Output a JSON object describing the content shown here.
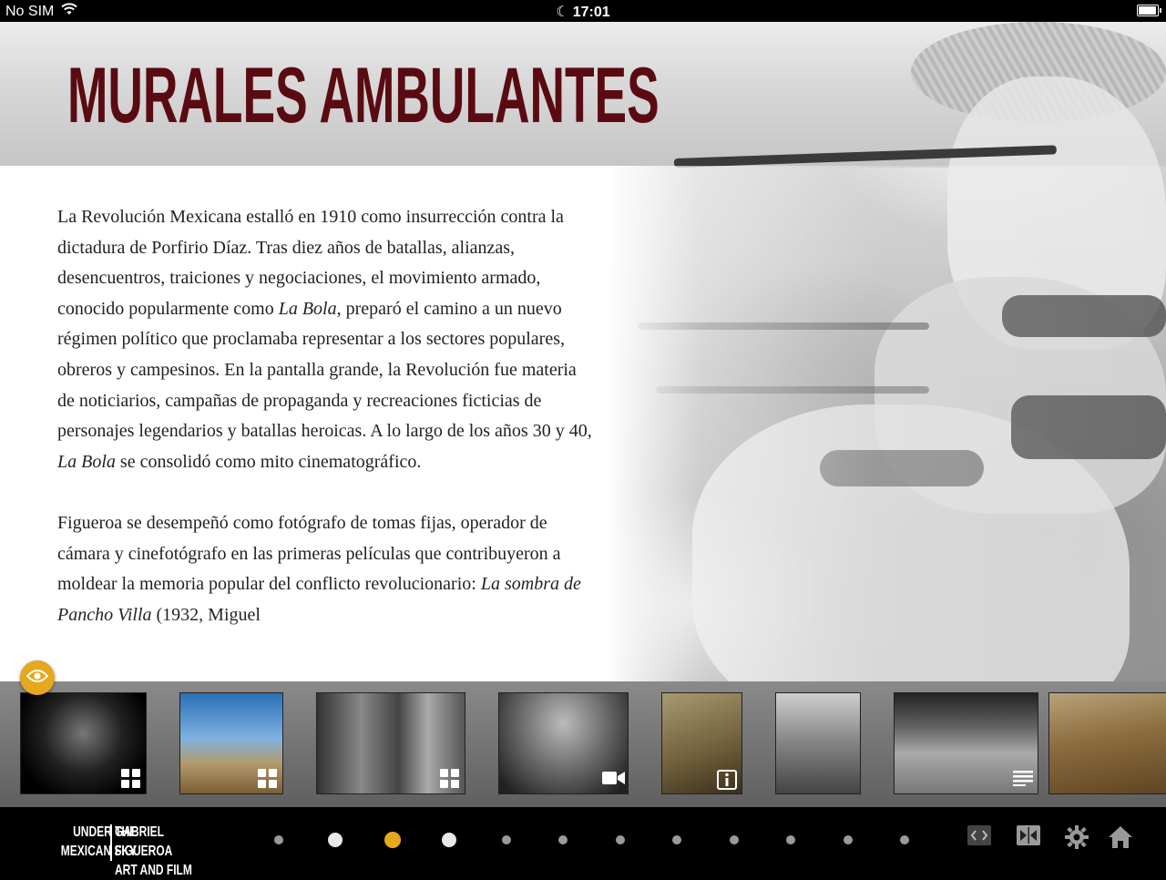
{
  "status_bar": {
    "carrier": "No SIM",
    "time": "17:01",
    "battery_level": 0.95
  },
  "page": {
    "title": "MURALES AMBULANTES",
    "title_color": "#5a0b12"
  },
  "article": {
    "paragraph1_a": "La Revolución Mexicana estalló en 1910 como insurrección contra la dictadura de Porfirio Díaz. Tras diez años de batallas, alianzas, desencuentros, traiciones y negociaciones, el movimiento armado, conocido popularmente como ",
    "paragraph1_italic1": "La Bola,",
    "paragraph1_b": " preparó el camino a un nuevo régimen político que proclamaba representar a los sectores populares, obreros y campesinos. En la pantalla grande, la Revolución fue materia de noticiarios, campañas de propaganda y recreaciones ficticias de personajes legendarios y batallas heroicas. A lo largo de los años 30 y 40, ",
    "paragraph1_italic2": "La Bola",
    "paragraph1_c": " se consolidó como mito cinematográfico.",
    "paragraph2_a": "Figueroa se desempeñó como fotógrafo de tomas fijas, operador de cámara y cinefotógrafo en las primeras películas que contribuyeron a moldear la memoria popular del conflicto revolucionario: ",
    "paragraph2_italic": "La sombra de Pancho Villa",
    "paragraph2_b": " (1932, Miguel"
  },
  "view_button": {
    "icon": "eye-icon",
    "color": "#e6a81c"
  },
  "thumbnails": [
    {
      "kind": "gallery",
      "icon": "grid-icon"
    },
    {
      "kind": "gallery",
      "icon": "grid-icon"
    },
    {
      "kind": "gallery",
      "icon": "grid-icon"
    },
    {
      "kind": "video",
      "icon": "video-camera-icon"
    },
    {
      "kind": "info",
      "icon": "info-icon"
    },
    {
      "kind": "image",
      "icon": ""
    },
    {
      "kind": "text",
      "icon": "text-lines-icon"
    },
    {
      "kind": "image",
      "icon": ""
    }
  ],
  "footer": {
    "logo_line1_left": "UNDER THE",
    "logo_line2_left": "MEXICAN SKY",
    "logo_line1_right": "GABRIEL FIGUEROA",
    "logo_line2_right": "ART AND FILM",
    "page_dots": {
      "count": 12,
      "current_index": 2,
      "active_color": "#e6a81c"
    },
    "tools": [
      "code-brackets-icon",
      "compare-icon",
      "gear-icon",
      "home-icon"
    ]
  }
}
